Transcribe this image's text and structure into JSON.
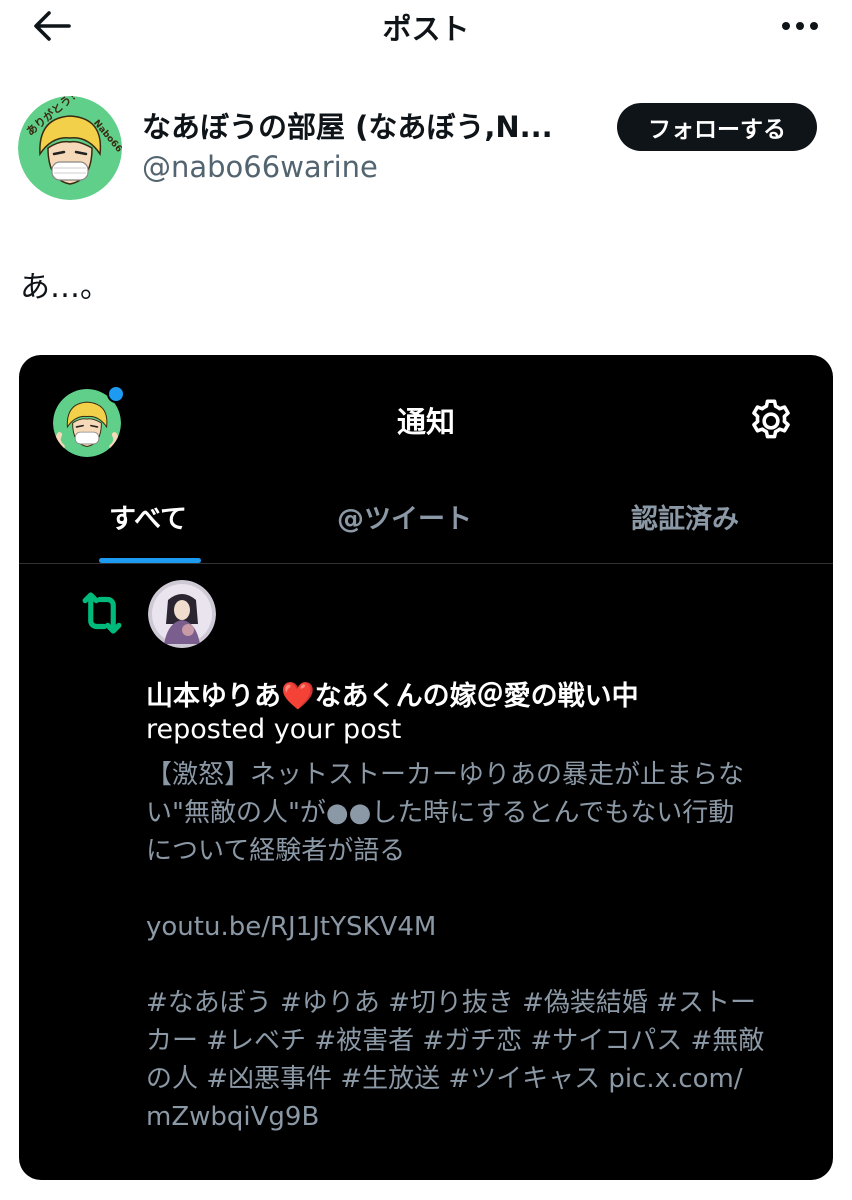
{
  "topbar": {
    "title": "ポスト"
  },
  "post": {
    "author_name": "なあぼうの部屋 (なあぼう,N...",
    "author_handle": "@nabo66warine",
    "follow_label": "フォローする",
    "text": "あ…。",
    "avatar_text": "ありがとう！",
    "avatar_text2": "Nabo66"
  },
  "embed": {
    "title": "通知",
    "tabs": [
      "すべて",
      "@ツイート",
      "認証済み"
    ],
    "notification": {
      "user_name": "山本ゆりあ❤️なあくんの嫁＠愛の戦い中",
      "action": "reposted your post",
      "body_lines": [
        "【激怒】ネットストーカーゆりあの暴走が止まらな",
        "い\"無敵の人\"が●●した時にするとんでもない行動",
        "について経験者が語る"
      ],
      "link": "youtu.be/RJ1JtYSKV4M",
      "tag_lines": [
        "#なあぼう #ゆりあ #切り抜き #偽装結婚 #ストー",
        "カー #レベチ #被害者 #ガチ恋 #サイコパス #無敵",
        "の人 #凶悪事件 #生放送 #ツイキャス pic.x.com/",
        "mZwbqiVg9B"
      ]
    }
  },
  "colors": {
    "accent": "#1d9bf0",
    "repost_green": "#00ba7c",
    "avatar_bg": "#5fcf8a",
    "embed_bg": "#000000",
    "muted_text": "#8b98a5"
  },
  "icons": {
    "back": "arrow-left-icon",
    "more": "more-horizontal-icon",
    "settings": "gear-icon",
    "repost": "repost-icon"
  }
}
